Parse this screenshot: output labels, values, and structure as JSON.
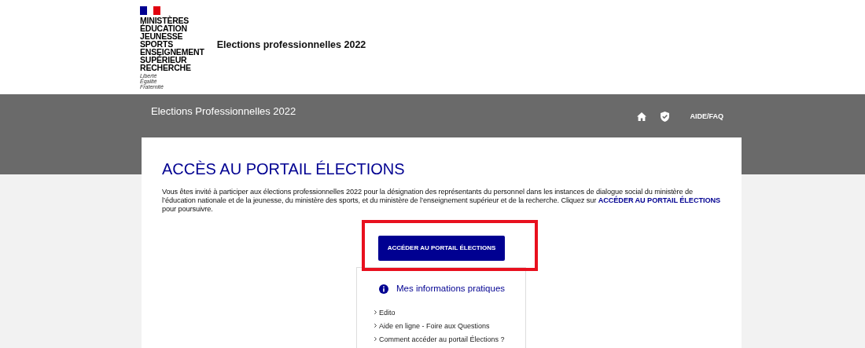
{
  "logo": {
    "lines": [
      "MINISTÈRES",
      "ÉDUCATION",
      "JEUNESSE",
      "SPORTS",
      "ENSEIGNEMENT",
      "SUPÉRIEUR",
      "RECHERCHE"
    ],
    "motto": [
      "Liberté",
      "Égalité",
      "Fraternité"
    ]
  },
  "site_title": "Elections professionnelles 2022",
  "band": {
    "title": "Elections Professionnelles 2022",
    "nav": [
      {
        "kind": "home"
      },
      {
        "kind": "shield"
      },
      {
        "kind": "text",
        "label": "AIDE/FAQ"
      }
    ]
  },
  "main": {
    "heading": "ACCÈS AU PORTAIL ÉLECTIONS",
    "intro": "Vous êtes invité à participer aux élections professionnelles 2022 pour la désignation des représentants du personnel dans les instances de dialogue social du ministère de l’éducation nationale et de la jeunesse, du ministère des sports, et du ministère de l’enseignement supérieur et de la recherche. Cliquez sur **ACCÉDER AU PORTAIL ÉLECTIONS** pour poursuivre.",
    "button": {
      "label": "ACCÉDER AU PORTAIL ÉLECTIONS",
      "highlighted": true
    }
  },
  "info": {
    "title": "Mes informations pratiques",
    "links": [
      "Edito",
      "Aide en ligne - Foire aux Questions",
      "Comment accéder au portail Élections ?"
    ]
  }
}
